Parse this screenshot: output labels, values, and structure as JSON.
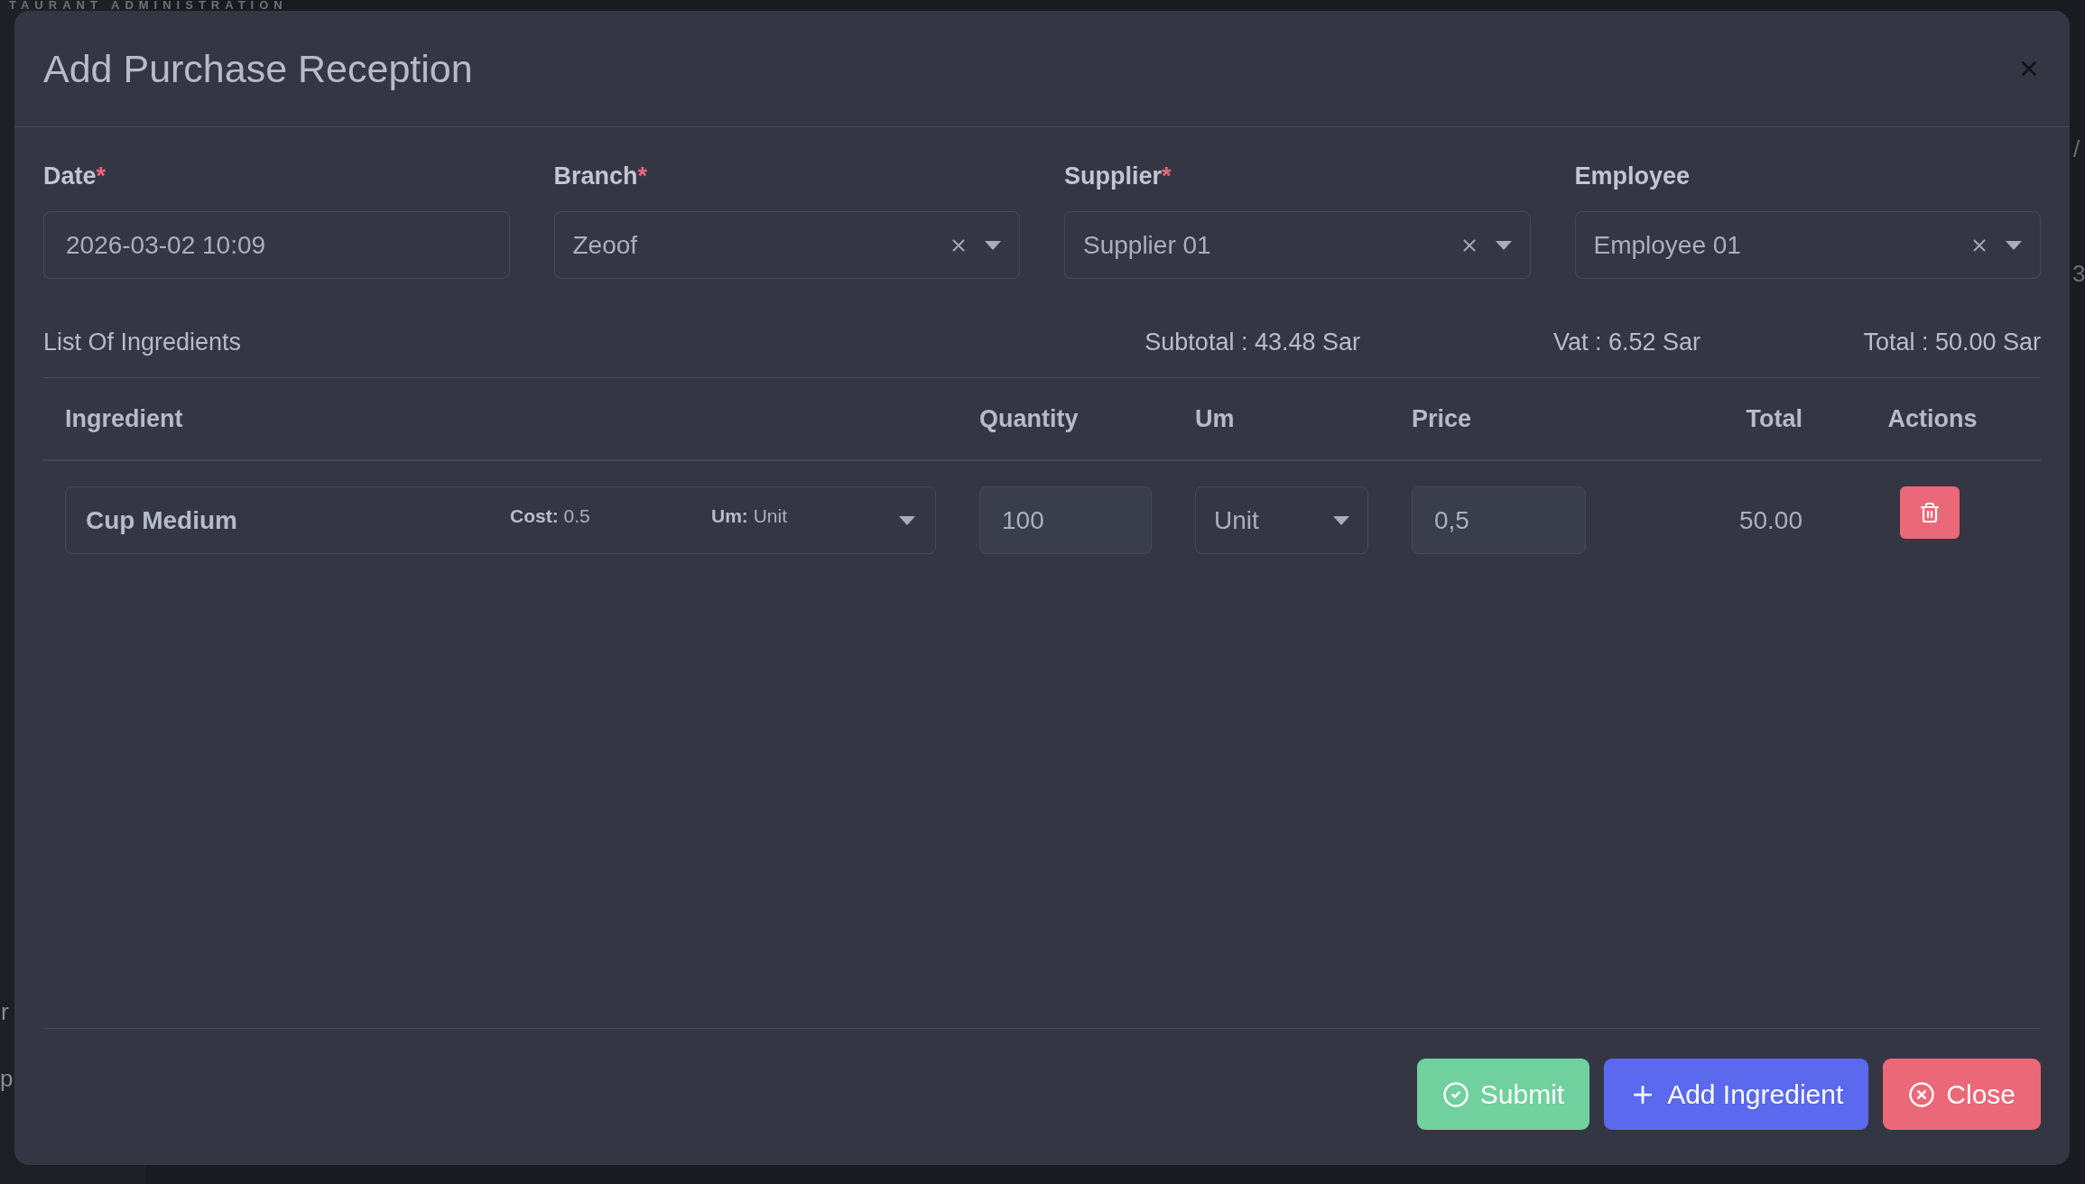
{
  "background_page": {
    "heading": "TAURANT ADMINISTRATION",
    "left_edge_texts": [
      "r",
      "p"
    ],
    "right_edge_texts": [
      "/",
      "3"
    ]
  },
  "dialog": {
    "title": "Add Purchase Reception",
    "fields": [
      {
        "kind": "input",
        "label": "Date",
        "required_mark": "*",
        "value": "2026-03-02 10:09"
      },
      {
        "kind": "select",
        "label": "Branch",
        "required_mark": "*",
        "value": "Zeoof"
      },
      {
        "kind": "select",
        "label": "Supplier",
        "required_mark": "*",
        "value": "Supplier 01"
      },
      {
        "kind": "select",
        "label": "Employee",
        "value": "Employee 01"
      }
    ],
    "ingredients": {
      "title": "List Of Ingredients",
      "totals": [
        "Subtotal : 43.48 Sar",
        "Vat : 6.52 Sar",
        "Total : 50.00 Sar"
      ],
      "columns": [
        "Ingredient",
        "Quantity",
        "Um",
        "Price",
        "Total",
        "Actions"
      ],
      "rows": [
        {
          "ingredient": {
            "name": "Cup Medium",
            "cost": "**Cost:** 0.5",
            "um": "**Um:** Unit"
          },
          "quantity": "100",
          "um": "Unit",
          "price": "0,5",
          "total": "50.00",
          "actions": [
            {
              "kind": "delete"
            }
          ]
        }
      ]
    },
    "buttons": [
      {
        "kind": "submit",
        "label": "Submit"
      },
      {
        "kind": "add",
        "label": "Add Ingredient"
      },
      {
        "kind": "close",
        "label": "Close"
      }
    ]
  }
}
